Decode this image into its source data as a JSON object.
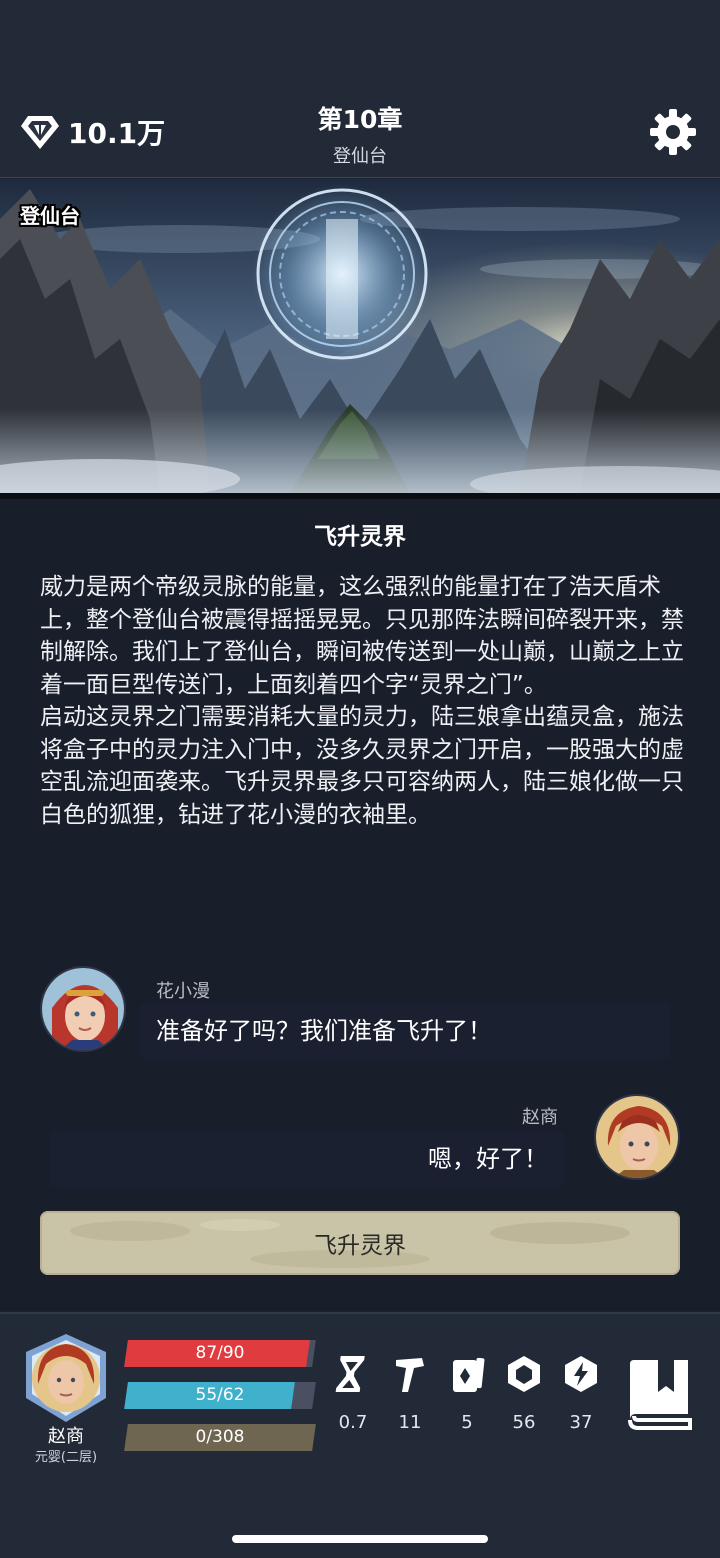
{
  "header": {
    "currency_amount": "10.1万",
    "chapter_title": "第10章",
    "chapter_subtitle": "登仙台"
  },
  "scene": {
    "location_label": "登仙台"
  },
  "story": {
    "title": "飞升灵界",
    "paragraphs": [
      "威力是两个帝级灵脉的能量，这么强烈的能量打在了浩天盾术上，整个登仙台被震得摇摇晃晃。只见那阵法瞬间碎裂开来，禁制解除。我们上了登仙台，瞬间被传送到一处山巅，山巅之上立着一面巨型传送门，上面刻着四个字“灵界之门”。",
      "启动这灵界之门需要消耗大量的灵力，陆三娘拿出蕴灵盒，施法将盒子中的灵力注入门中，没多久灵界之门开启，一股强大的虚空乱流迎面袭来。飞升灵界最多只可容纳两人，陆三娘化做一只白色的狐狸，钻进了花小漫的衣袖里。"
    ],
    "dialogue": [
      {
        "speaker": "花小漫",
        "text": "准备好了吗？我们准备飞升了！"
      },
      {
        "speaker": "赵商",
        "text": "嗯，好了！"
      }
    ],
    "action_button": "飞升灵界"
  },
  "player": {
    "name": "赵商",
    "realm": "元婴(二层)",
    "hp": {
      "label": "87/90",
      "current": 87,
      "max": 90
    },
    "mp": {
      "label": "55/62",
      "current": 55,
      "max": 62
    },
    "xp": {
      "label": "0/308",
      "current": 0,
      "max": 308
    }
  },
  "stats": [
    {
      "icon": "hourglass-icon",
      "value": "0.7"
    },
    {
      "icon": "hammer-icon",
      "value": "11"
    },
    {
      "icon": "cards-icon",
      "value": "5"
    },
    {
      "icon": "hexagon-icon",
      "value": "56"
    },
    {
      "icon": "lightning-shield-icon",
      "value": "37"
    }
  ],
  "colors": {
    "hp": "#e03c3f",
    "mp": "#3fb1cc",
    "xp": "#6e6650",
    "background": "#191e2b",
    "action_button": "#c9c3a8"
  }
}
